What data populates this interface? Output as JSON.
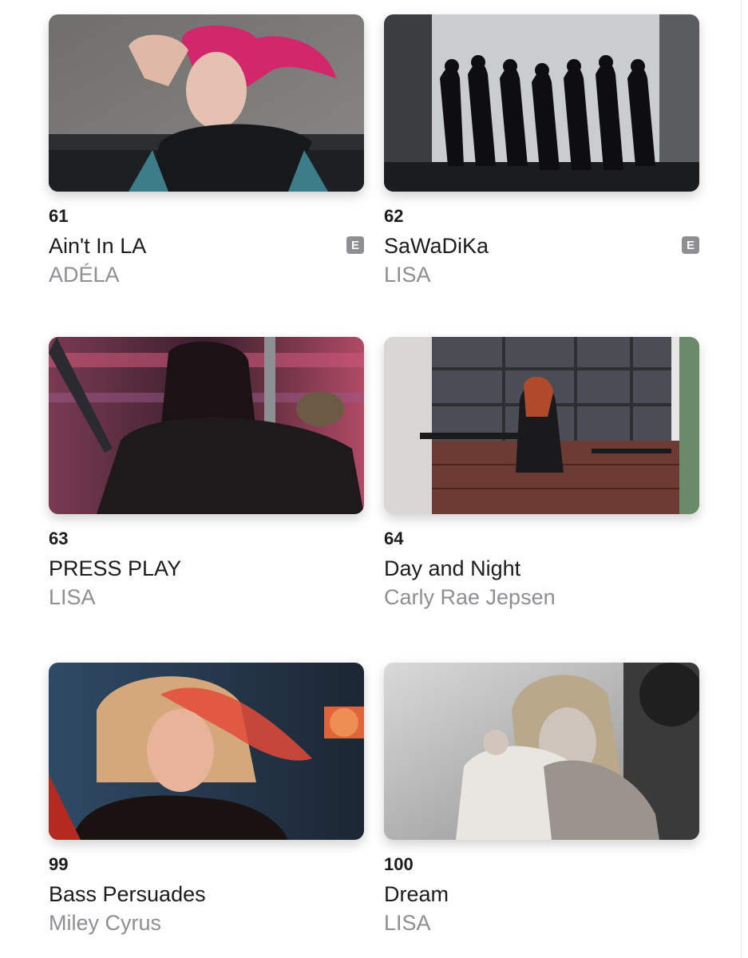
{
  "videos": [
    {
      "rank": "61",
      "title": "Ain't In LA",
      "artist": "ADÉLA",
      "explicit": "E"
    },
    {
      "rank": "62",
      "title": "SaWaDiKa",
      "artist": "LISA",
      "explicit": "E"
    },
    {
      "rank": "63",
      "title": "PRESS PLAY",
      "artist": "LISA"
    },
    {
      "rank": "64",
      "title": "Day and Night",
      "artist": "Carly Rae Jepsen"
    },
    {
      "rank": "99",
      "title": "Bass Persuades",
      "artist": "Miley Cyrus"
    },
    {
      "rank": "100",
      "title": "Dream",
      "artist": "LISA"
    }
  ],
  "colors": {
    "background": "#ffffff",
    "primary_text": "#1c1c1e",
    "secondary_text": "#8e8e93",
    "explicit_badge": "#8e8e93"
  }
}
